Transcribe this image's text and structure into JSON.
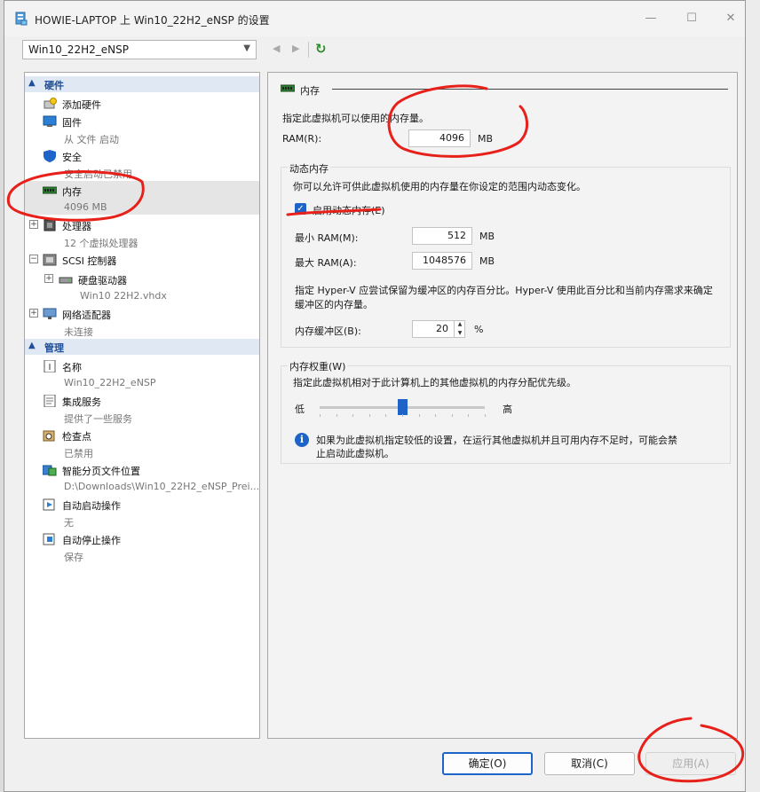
{
  "window": {
    "title": "HOWIE-LAPTOP 上 Win10_22H2_eNSP 的设置",
    "minimize": "—",
    "maximize": "☐",
    "close": "✕"
  },
  "toolbar": {
    "vm_selected": "Win10_22H2_eNSP"
  },
  "left": {
    "hardware_header": "硬件",
    "management_header": "管理",
    "hardware": [
      {
        "label": "添加硬件",
        "sub": ""
      },
      {
        "label": "固件",
        "sub": "从 文件 启动"
      },
      {
        "label": "安全",
        "sub": "安全启动已禁用"
      },
      {
        "label": "内存",
        "sub": "4096 MB"
      },
      {
        "label": "处理器",
        "sub": "12 个虚拟处理器"
      },
      {
        "label": "SCSI 控制器",
        "sub": ""
      },
      {
        "label": "硬盘驱动器",
        "sub": "Win10 22H2.vhdx"
      },
      {
        "label": "网络适配器",
        "sub": "未连接"
      }
    ],
    "management": [
      {
        "label": "名称",
        "sub": "Win10_22H2_eNSP"
      },
      {
        "label": "集成服务",
        "sub": "提供了一些服务"
      },
      {
        "label": "检查点",
        "sub": "已禁用"
      },
      {
        "label": "智能分页文件位置",
        "sub": "D:\\Downloads\\Win10_22H2_eNSP_Prei..."
      },
      {
        "label": "自动启动操作",
        "sub": "无"
      },
      {
        "label": "自动停止操作",
        "sub": "保存"
      }
    ]
  },
  "memory": {
    "section_title": "内存",
    "desc": "指定此虚拟机可以使用的内存量。",
    "ram_label": "RAM(R):",
    "ram_value": "4096",
    "ram_unit": "MB",
    "dynamic_title": "动态内存",
    "dynamic_desc": "你可以允许可供此虚拟机使用的内存量在你设定的范围内动态变化。",
    "enable_dynamic_label": "启用动态内存(E)",
    "enable_dynamic_checked": true,
    "min_label": "最小 RAM(M):",
    "min_value": "512",
    "min_unit": "MB",
    "max_label": "最大 RAM(A):",
    "max_value": "1048576",
    "max_unit": "MB",
    "buffer_desc_1": "指定 Hyper-V 应尝试保留为缓冲区的内存百分比。Hyper-V 使用此百分比和当前内存需求来确定",
    "buffer_desc_2": "缓冲区的内存量。",
    "buffer_label": "内存缓冲区(B):",
    "buffer_value": "20",
    "buffer_unit": "%",
    "weight_title": "内存权重(W)",
    "weight_desc": "指定此虚拟机相对于此计算机上的其他虚拟机的内存分配优先级。",
    "weight_low": "低",
    "weight_high": "高",
    "weight_level": 0.5,
    "info_1": "如果为此虚拟机指定较低的设置，在运行其他虚拟机并且可用内存不足时，可能会禁",
    "info_2": "止启动此虚拟机。"
  },
  "buttons": {
    "ok": "确定(O)",
    "cancel": "取消(C)",
    "apply": "应用(A)"
  },
  "colors": {
    "accent": "#1e64c8",
    "annotation": "#e8201a"
  }
}
